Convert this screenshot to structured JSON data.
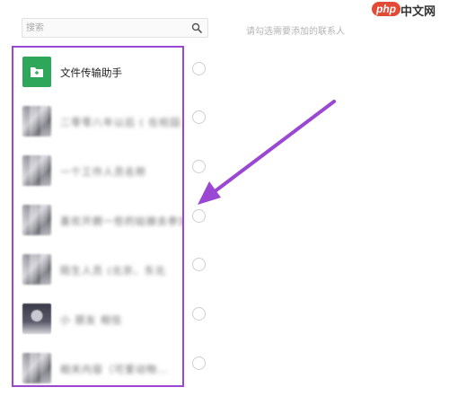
{
  "search": {
    "placeholder": "搜索"
  },
  "hint": "请勾选需要添加的联系人",
  "watermark": {
    "brand": "php",
    "site": "中文网"
  },
  "contacts": [
    {
      "name": "文件传输助手",
      "avatar": "folder-icon",
      "checked": false
    },
    {
      "name": "二零零八年以后 ( 在校园",
      "avatar": "blurred-photo",
      "checked": false
    },
    {
      "name": "一个工作人员名称",
      "avatar": "blurred-photo",
      "checked": false
    },
    {
      "name": "喜欢开朗一些的姑娘去参加",
      "avatar": "blurred-photo",
      "checked": false
    },
    {
      "name": "陌生人员 (北京、东北",
      "avatar": "blurred-photo",
      "checked": false
    },
    {
      "name": "小 朋友 相信",
      "avatar": "person-photo",
      "checked": false
    },
    {
      "name": "相关内容（可爱动物…",
      "avatar": "blurred-photo",
      "checked": false
    }
  ],
  "colors": {
    "highlight": "#9a48d3",
    "filehelper": "#2ea75a",
    "arrow": "#9a48d3"
  }
}
